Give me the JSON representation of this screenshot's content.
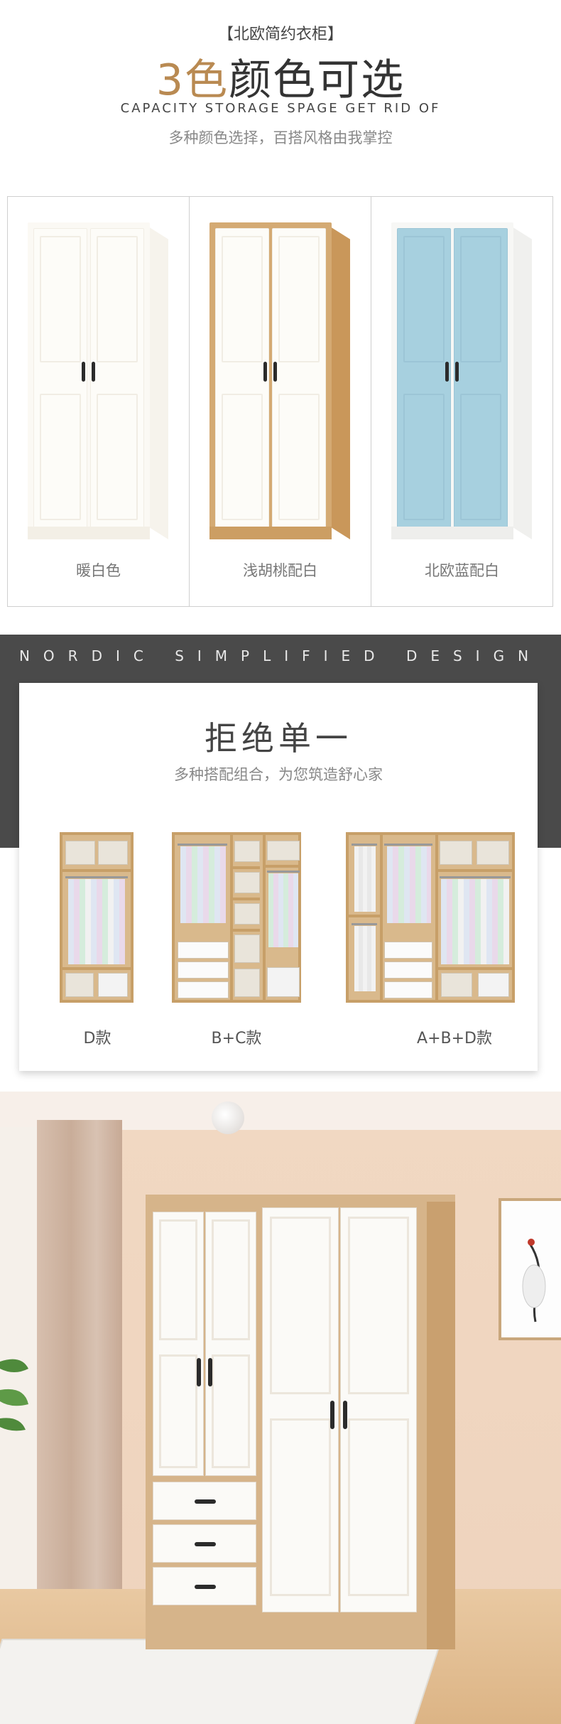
{
  "header": {
    "tag": "【北欧简约衣柜】",
    "title_accent": "3色",
    "title_rest": "颜色可选",
    "english": "CAPACITY STORAGE SPAGE GET RID OF",
    "subtitle": "多种颜色选择，百搭风格由我掌控"
  },
  "colors": [
    {
      "label": "暖白色",
      "front": "#fbf9f4",
      "door": "#fdfcf8",
      "panel": "#f1ede4",
      "side": "#f6f3ec",
      "plinth": "#f3efe6"
    },
    {
      "label": "浅胡桃配白",
      "front": "#d4aa73",
      "door": "#fdfcf8",
      "panel": "#f1ede4",
      "side": "#c9975a",
      "plinth": "#cc9e63"
    },
    {
      "label": "北欧蓝配白",
      "front": "#f7f7f5",
      "door": "#a7d0df",
      "panel": "#9cc5d6",
      "side": "#f0f0ee",
      "plinth": "#eeeeec"
    }
  ],
  "nordic": {
    "english": "NORDIC SIMPLIFIED DESIGN",
    "title": "拒绝单一",
    "subtitle": "多种搭配组合，为您筑造舒心家"
  },
  "options": [
    {
      "label": "D款"
    },
    {
      "label": "B+C款"
    },
    {
      "label": "A+B+D款"
    }
  ],
  "accent_color": "#b98a52",
  "band_color": "#4a4a4a"
}
